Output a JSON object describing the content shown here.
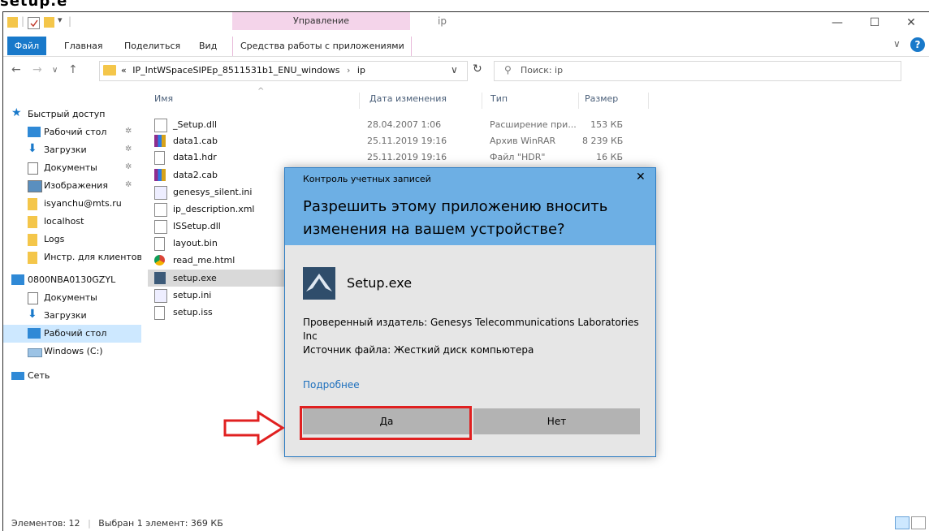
{
  "caption": "setup.e",
  "window": {
    "manage_tab": "Управление",
    "title": "ip",
    "controls": {
      "minimize": "—",
      "maximize": "☐",
      "close": "✕"
    }
  },
  "ribbon": {
    "tabs": [
      "Файл",
      "Главная",
      "Поделиться",
      "Вид",
      "Средства работы с приложениями"
    ],
    "help": "?"
  },
  "address": {
    "prefix": "«",
    "path": [
      "IP_IntWSpaceSIPEp_8511531b1_ENU_windows",
      "ip"
    ],
    "search_placeholder": "Поиск: ip"
  },
  "sidebar": {
    "items": [
      {
        "label": "Быстрый доступ",
        "icon": "star-icon",
        "pinned": false
      },
      {
        "label": "Рабочий стол",
        "icon": "desktop-icon",
        "pinned": true
      },
      {
        "label": "Загрузки",
        "icon": "downloads-icon",
        "pinned": true
      },
      {
        "label": "Документы",
        "icon": "documents-icon",
        "pinned": true
      },
      {
        "label": "Изображения",
        "icon": "pictures-icon",
        "pinned": true
      },
      {
        "label": "isyanchu@mts.ru",
        "icon": "folder-icon",
        "pinned": false
      },
      {
        "label": "localhost",
        "icon": "folder-icon",
        "pinned": false
      },
      {
        "label": "Logs",
        "icon": "folder-icon",
        "pinned": false
      },
      {
        "label": "Инстр. для клиентов",
        "icon": "folder-icon",
        "pinned": false
      },
      {
        "label": "0800NBA0130GZYL",
        "icon": "computer-icon",
        "pinned": false
      },
      {
        "label": "Документы",
        "icon": "documents-icon",
        "pinned": false
      },
      {
        "label": "Загрузки",
        "icon": "downloads-icon",
        "pinned": false
      },
      {
        "label": "Рабочий стол",
        "icon": "desktop-icon",
        "pinned": false
      },
      {
        "label": "Windows (C:)",
        "icon": "drive-icon",
        "pinned": false
      },
      {
        "label": "Сеть",
        "icon": "network-icon",
        "pinned": false
      }
    ],
    "selected": "Рабочий стол",
    "pin_glyph": "✲"
  },
  "files": {
    "columns": [
      "Имя",
      "Дата изменения",
      "Тип",
      "Размер"
    ],
    "rows": [
      {
        "name": "_Setup.dll",
        "date": "28.04.2007 1:06",
        "type": "Расширение при...",
        "size": "153 КБ",
        "icon": "dll-icon"
      },
      {
        "name": "data1.cab",
        "date": "25.11.2019 19:16",
        "type": "Архив WinRAR",
        "size": "8 239 КБ",
        "icon": "winrar-icon"
      },
      {
        "name": "data1.hdr",
        "date": "25.11.2019 19:16",
        "type": "Файл \"HDR\"",
        "size": "16 КБ",
        "icon": "file-icon"
      },
      {
        "name": "data2.cab",
        "date": "",
        "type": "",
        "size": "",
        "icon": "winrar-icon"
      },
      {
        "name": "genesys_silent.ini",
        "date": "",
        "type": "",
        "size": "",
        "icon": "ini-icon"
      },
      {
        "name": "ip_description.xml",
        "date": "",
        "type": "",
        "size": "",
        "icon": "xml-icon"
      },
      {
        "name": "ISSetup.dll",
        "date": "",
        "type": "",
        "size": "",
        "icon": "dll-icon"
      },
      {
        "name": "layout.bin",
        "date": "",
        "type": "",
        "size": "",
        "icon": "file-icon"
      },
      {
        "name": "read_me.html",
        "date": "",
        "type": "",
        "size": "",
        "icon": "chrome-icon"
      },
      {
        "name": "setup.exe",
        "date": "",
        "type": "",
        "size": "",
        "icon": "setup-icon"
      },
      {
        "name": "setup.ini",
        "date": "",
        "type": "",
        "size": "",
        "icon": "ini-icon"
      },
      {
        "name": "setup.iss",
        "date": "",
        "type": "",
        "size": "",
        "icon": "file-icon"
      }
    ],
    "selected": "setup.exe"
  },
  "status": {
    "count": "Элементов: 12",
    "selection": "Выбран 1 элемент: 369 КБ"
  },
  "uac": {
    "caption": "Контроль учетных записей",
    "question": "Разрешить этому приложению вносить изменения на вашем устройстве?",
    "app_name": "Setup.exe",
    "publisher": "Проверенный издатель: Genesys Telecommunications Laboratories Inc",
    "source": "Источник файла: Жесткий диск компьютера",
    "more": "Подробнее",
    "yes": "Да",
    "no": "Нет"
  },
  "colors": {
    "accent": "#1979ca",
    "uac_header": "#6dafe4",
    "highlight": "#e02020",
    "selection": "#cde8ff",
    "context_tab": "#f4d4ea"
  }
}
